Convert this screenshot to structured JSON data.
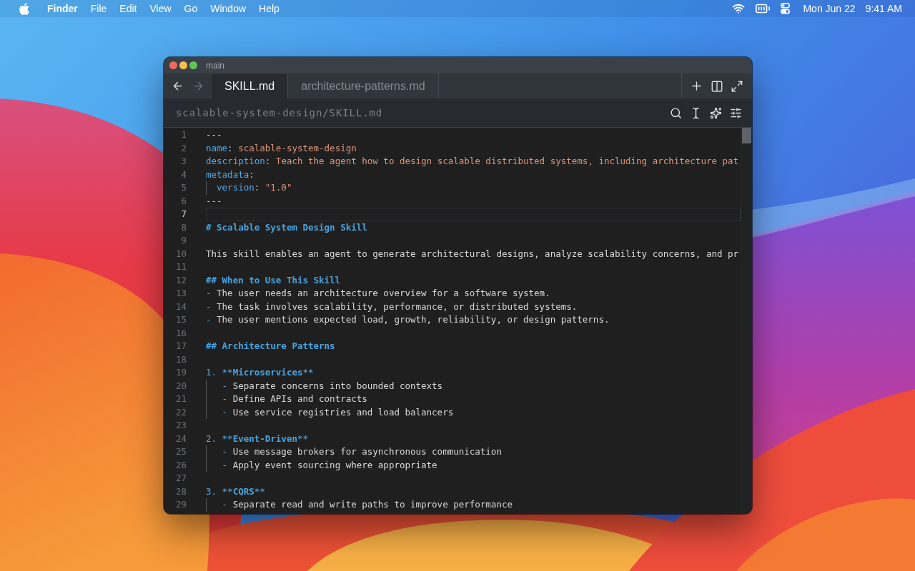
{
  "menu_bar": {
    "app_name": "Finder",
    "menus": [
      "File",
      "Edit",
      "View",
      "Go",
      "Window",
      "Help"
    ],
    "date": "Mon Jun 22",
    "time": "9:41 AM"
  },
  "window": {
    "title": "main",
    "traffic_lights": [
      {
        "color": "#ed6a5e"
      },
      {
        "color": "#f4bf4f"
      },
      {
        "color": "#61c554"
      }
    ],
    "nav_buttons": [
      {
        "kind": "back",
        "disabled": false
      },
      {
        "kind": "forward",
        "disabled": true
      }
    ],
    "tabs": [
      {
        "label": "SKILL.md",
        "selected": true
      },
      {
        "label": "architecture-patterns.md",
        "selected": false
      }
    ],
    "path": "scalable-system-design/SKILL.md",
    "editor": {
      "lines": [
        {
          "number": "1",
          "current": false,
          "guide": false,
          "tokens": [
            {
              "kind": "punct",
              "text": "---"
            }
          ]
        },
        {
          "number": "2",
          "current": false,
          "guide": false,
          "tokens": [
            {
              "kind": "key",
              "text": "name"
            },
            {
              "kind": "punct",
              "text": ": "
            },
            {
              "kind": "string",
              "text": "scalable-system-design"
            }
          ]
        },
        {
          "number": "3",
          "current": false,
          "guide": false,
          "tokens": [
            {
              "kind": "key",
              "text": "description"
            },
            {
              "kind": "punct",
              "text": ": "
            },
            {
              "kind": "string",
              "text": "Teach the agent how to design scalable distributed systems, including architecture pat"
            }
          ]
        },
        {
          "number": "4",
          "current": false,
          "guide": false,
          "tokens": [
            {
              "kind": "key",
              "text": "metadata"
            },
            {
              "kind": "punct",
              "text": ":"
            }
          ]
        },
        {
          "number": "5",
          "current": false,
          "guide": true,
          "tokens": [
            {
              "kind": "key",
              "text": "  version"
            },
            {
              "kind": "punct",
              "text": ": "
            },
            {
              "kind": "string",
              "text": "\"1.0\""
            }
          ]
        },
        {
          "number": "6",
          "current": false,
          "guide": false,
          "tokens": [
            {
              "kind": "punct",
              "text": "---"
            }
          ]
        },
        {
          "number": "7",
          "current": true,
          "guide": false
        },
        {
          "number": "8",
          "current": false,
          "guide": false,
          "tokens": [
            {
              "kind": "heading",
              "text": "# Scalable System Design Skill"
            }
          ]
        },
        {
          "number": "9",
          "current": false,
          "guide": false
        },
        {
          "number": "10",
          "current": false,
          "guide": false,
          "tokens": [
            {
              "kind": "text",
              "text": "This skill enables an agent to generate architectural designs, analyze scalability concerns, and pr"
            }
          ]
        },
        {
          "number": "11",
          "current": false,
          "guide": false
        },
        {
          "number": "12",
          "current": false,
          "guide": false,
          "tokens": [
            {
              "kind": "heading",
              "text": "## When to Use This Skill"
            }
          ]
        },
        {
          "number": "13",
          "current": false,
          "guide": false,
          "tokens": [
            {
              "kind": "bullet",
              "text": "- "
            },
            {
              "kind": "text",
              "text": "The user needs an architecture overview for a software system."
            }
          ]
        },
        {
          "number": "14",
          "current": false,
          "guide": false,
          "tokens": [
            {
              "kind": "bullet",
              "text": "- "
            },
            {
              "kind": "text",
              "text": "The task involves scalability, performance, or distributed systems."
            }
          ]
        },
        {
          "number": "15",
          "current": false,
          "guide": false,
          "tokens": [
            {
              "kind": "bullet",
              "text": "- "
            },
            {
              "kind": "text",
              "text": "The user mentions expected load, growth, reliability, or design patterns."
            }
          ]
        },
        {
          "number": "16",
          "current": false,
          "guide": false
        },
        {
          "number": "17",
          "current": false,
          "guide": false,
          "tokens": [
            {
              "kind": "heading",
              "text": "## Architecture Patterns"
            }
          ]
        },
        {
          "number": "18",
          "current": false,
          "guide": false
        },
        {
          "number": "19",
          "current": false,
          "guide": false,
          "tokens": [
            {
              "kind": "number",
              "text": "1. "
            },
            {
              "kind": "marker",
              "text": "**"
            },
            {
              "kind": "strong",
              "text": "Microservices"
            },
            {
              "kind": "marker",
              "text": "**"
            }
          ]
        },
        {
          "number": "20",
          "current": false,
          "guide": true,
          "tokens": [
            {
              "kind": "bullet",
              "text": "   - "
            },
            {
              "kind": "text",
              "text": "Separate concerns into bounded contexts"
            }
          ]
        },
        {
          "number": "21",
          "current": false,
          "guide": true,
          "tokens": [
            {
              "kind": "bullet",
              "text": "   - "
            },
            {
              "kind": "text",
              "text": "Define APIs and contracts"
            }
          ]
        },
        {
          "number": "22",
          "current": false,
          "guide": true,
          "tokens": [
            {
              "kind": "bullet",
              "text": "   - "
            },
            {
              "kind": "text",
              "text": "Use service registries and load balancers"
            }
          ]
        },
        {
          "number": "23",
          "current": false,
          "guide": false
        },
        {
          "number": "24",
          "current": false,
          "guide": false,
          "tokens": [
            {
              "kind": "number",
              "text": "2. "
            },
            {
              "kind": "marker",
              "text": "**"
            },
            {
              "kind": "strong",
              "text": "Event-Driven"
            },
            {
              "kind": "marker",
              "text": "**"
            }
          ]
        },
        {
          "number": "25",
          "current": false,
          "guide": true,
          "tokens": [
            {
              "kind": "bullet",
              "text": "   - "
            },
            {
              "kind": "text",
              "text": "Use message brokers for asynchronous communication"
            }
          ]
        },
        {
          "number": "26",
          "current": false,
          "guide": true,
          "tokens": [
            {
              "kind": "bullet",
              "text": "   - "
            },
            {
              "kind": "text",
              "text": "Apply event sourcing where appropriate"
            }
          ]
        },
        {
          "number": "27",
          "current": false,
          "guide": false
        },
        {
          "number": "28",
          "current": false,
          "guide": false,
          "tokens": [
            {
              "kind": "number",
              "text": "3. "
            },
            {
              "kind": "marker",
              "text": "**"
            },
            {
              "kind": "strong",
              "text": "CQRS"
            },
            {
              "kind": "marker",
              "text": "**"
            }
          ]
        },
        {
          "number": "29",
          "current": false,
          "guide": true,
          "tokens": [
            {
              "kind": "bullet",
              "text": "   - "
            },
            {
              "kind": "text",
              "text": "Separate read and write paths to improve performance"
            }
          ]
        }
      ]
    }
  }
}
